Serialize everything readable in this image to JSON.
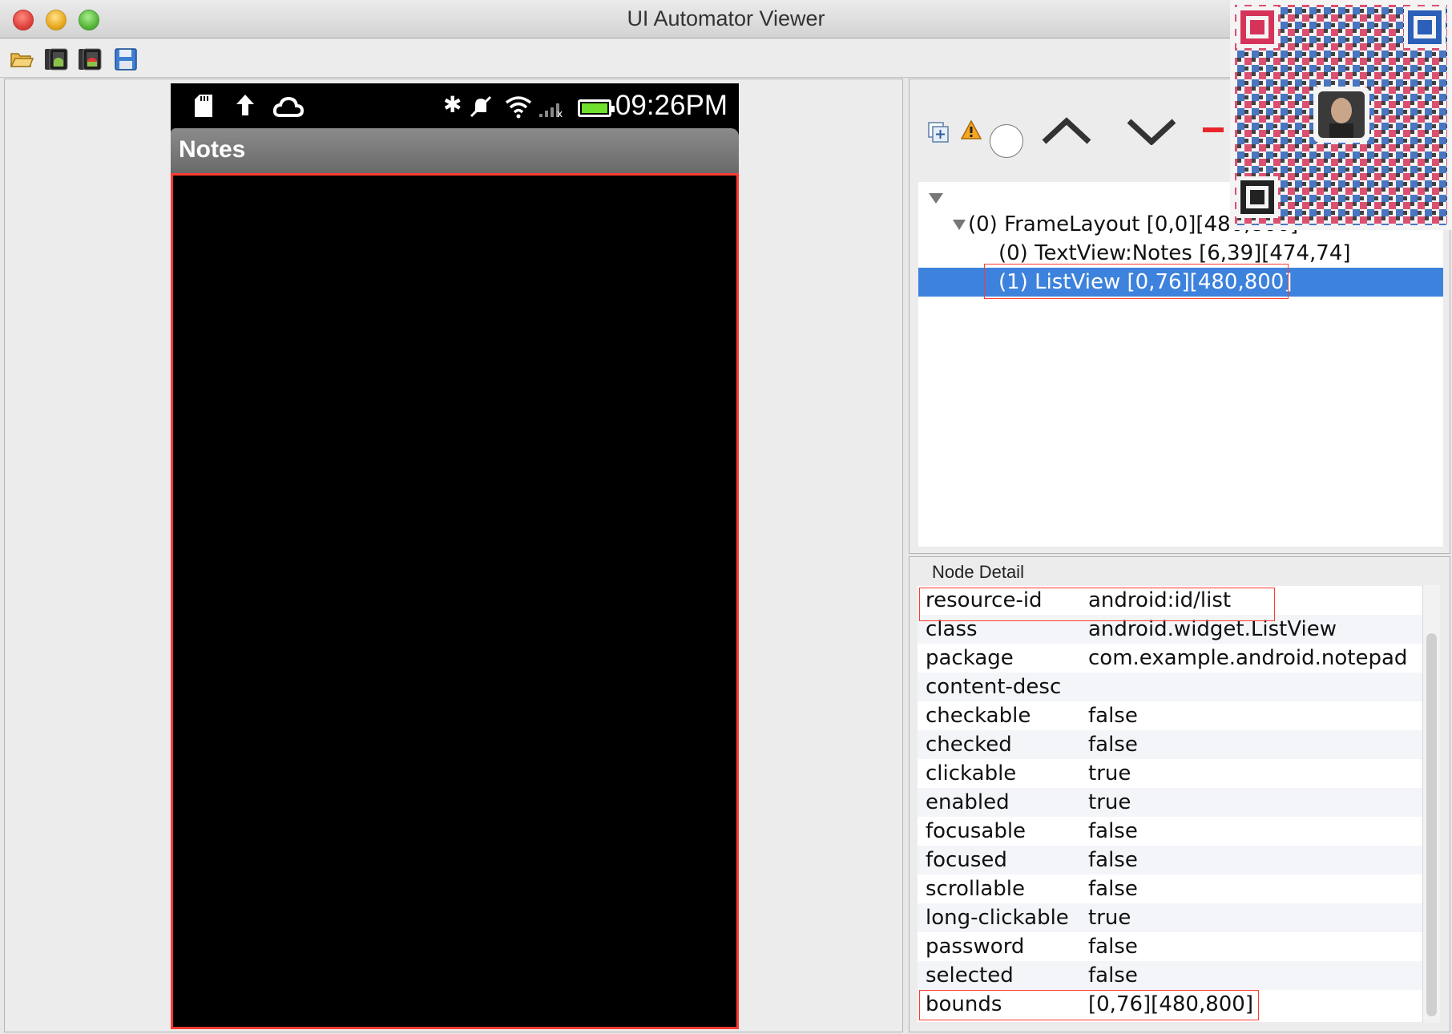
{
  "window": {
    "title": "UI Automator Viewer"
  },
  "toolbar": {
    "icons": [
      "open-folder-icon",
      "device-screenshot-icon",
      "device-screenshot-compressed-icon",
      "save-icon"
    ]
  },
  "device": {
    "status_bar": {
      "time": "09:26PM"
    },
    "app_bar": {
      "title": "Notes"
    }
  },
  "hierarchy": {
    "tools": [
      "expand-all-icon",
      "warning-icon",
      "toggle-naf-icon",
      "previous-node-icon",
      "next-node-icon",
      "remove-icon"
    ],
    "tree": [
      {
        "label": "(0) FrameLayout [0,0][480,800]",
        "level": 1,
        "expanded": true
      },
      {
        "label": "(0) TextView:Notes [6,39][474,74]",
        "level": 2
      },
      {
        "label": "(1) ListView [0,76][480,800]",
        "level": 2,
        "selected": true
      }
    ]
  },
  "node_detail": {
    "label": "Node Detail",
    "rows": [
      {
        "key": "resource-id",
        "value": "android:id/list"
      },
      {
        "key": "class",
        "value": "android.widget.ListView"
      },
      {
        "key": "package",
        "value": "com.example.android.notepad"
      },
      {
        "key": "content-desc",
        "value": ""
      },
      {
        "key": "checkable",
        "value": "false"
      },
      {
        "key": "checked",
        "value": "false"
      },
      {
        "key": "clickable",
        "value": "true"
      },
      {
        "key": "enabled",
        "value": "true"
      },
      {
        "key": "focusable",
        "value": "false"
      },
      {
        "key": "focused",
        "value": "false"
      },
      {
        "key": "scrollable",
        "value": "false"
      },
      {
        "key": "long-clickable",
        "value": "true"
      },
      {
        "key": "password",
        "value": "false"
      },
      {
        "key": "selected",
        "value": "false"
      },
      {
        "key": "bounds",
        "value": "[0,76][480,800]"
      }
    ]
  },
  "colors": {
    "selection": "#3d82dc",
    "highlight": "#ff3b30",
    "battery": "#6fe02b"
  }
}
